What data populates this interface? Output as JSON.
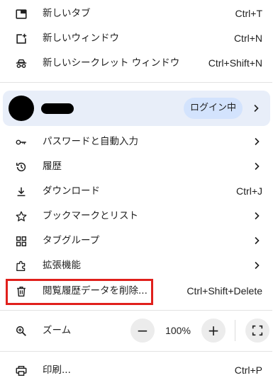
{
  "menu": {
    "new_tab": {
      "label": "新しいタブ",
      "shortcut": "Ctrl+T"
    },
    "new_window": {
      "label": "新しいウィンドウ",
      "shortcut": "Ctrl+N"
    },
    "new_incognito": {
      "label": "新しいシークレット ウィンドウ",
      "shortcut": "Ctrl+Shift+N"
    },
    "profile": {
      "status_badge": "ログイン中"
    },
    "passwords": {
      "label": "パスワードと自動入力"
    },
    "history": {
      "label": "履歴"
    },
    "downloads": {
      "label": "ダウンロード",
      "shortcut": "Ctrl+J"
    },
    "bookmarks": {
      "label": "ブックマークとリスト"
    },
    "tab_groups": {
      "label": "タブグループ"
    },
    "extensions": {
      "label": "拡張機能"
    },
    "clear_data": {
      "label": "閲覧履歴データを削除...",
      "shortcut": "Ctrl+Shift+Delete"
    },
    "zoom": {
      "label": "ズーム",
      "value": "100%",
      "minus": "−",
      "plus": "+"
    },
    "print": {
      "label": "印刷...",
      "shortcut": "Ctrl+P"
    }
  },
  "colors": {
    "highlight_border": "#e0201c",
    "profile_bg": "#e8eef9",
    "badge_bg": "#d3e3fd"
  },
  "icons": {
    "new_tab": "new-tab-icon",
    "new_window": "new-window-icon",
    "incognito": "incognito-icon",
    "passwords": "key-icon",
    "history": "history-icon",
    "downloads": "download-icon",
    "bookmarks": "star-icon",
    "tab_groups": "grid-icon",
    "extensions": "puzzle-icon",
    "clear_data": "trash-icon",
    "zoom": "zoom-icon",
    "fullscreen": "fullscreen-icon",
    "print": "print-icon"
  }
}
